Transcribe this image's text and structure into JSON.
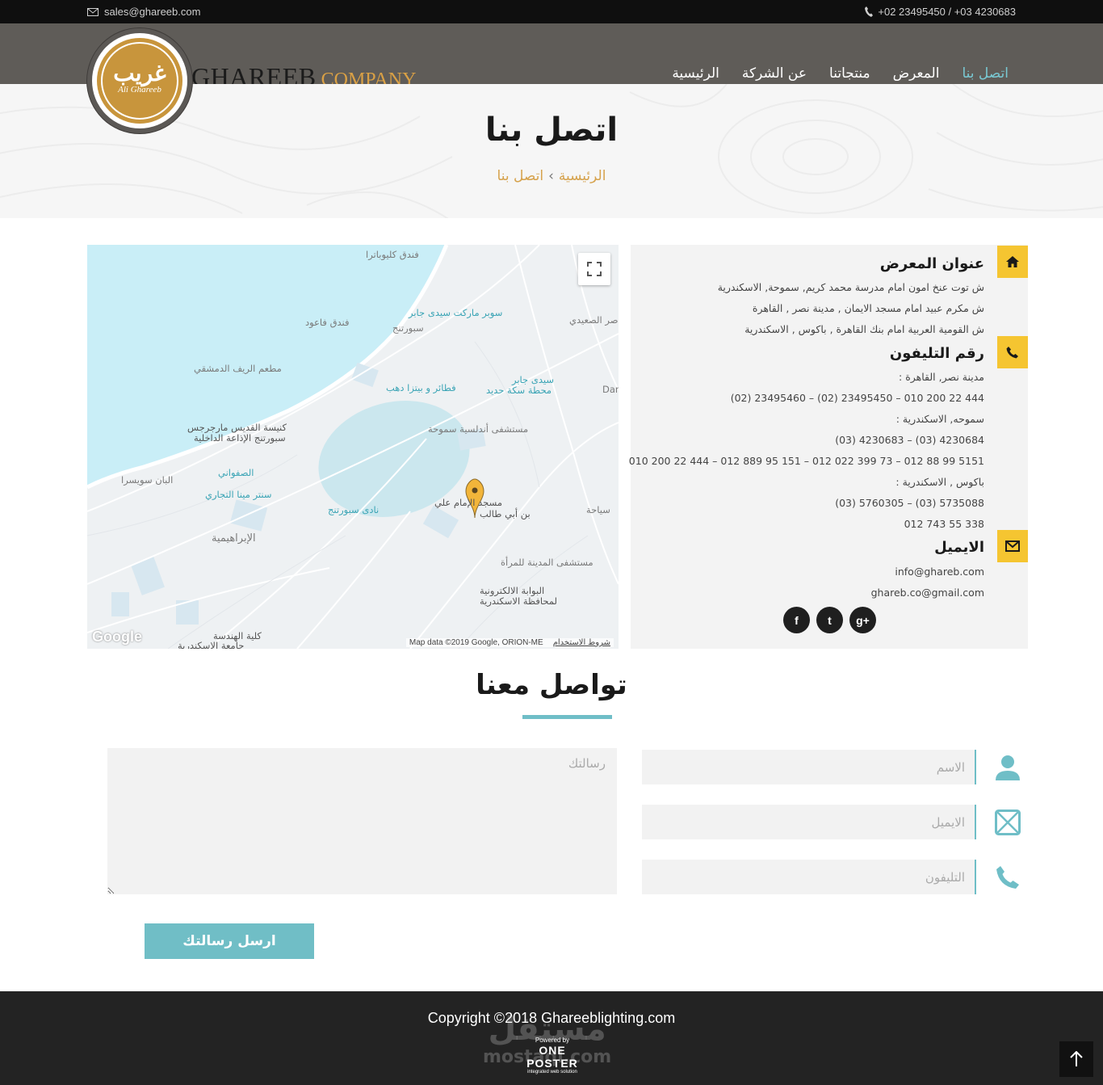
{
  "topbar": {
    "email": "sales@ghareeb.com",
    "phones": "+02 23495450 / +03 4230683"
  },
  "logo": {
    "arabic": "غريب",
    "english": "Ali Ghareeb"
  },
  "brand": {
    "name": "GHAREEB",
    "suffix": "COMPANY"
  },
  "nav": {
    "items": [
      {
        "label": "الرئيسية"
      },
      {
        "label": "عن الشركة"
      },
      {
        "label": "منتجاتنا"
      },
      {
        "label": "المعرض"
      },
      {
        "label": "اتصل بنا",
        "active": true
      }
    ]
  },
  "page": {
    "title": "اتصل بنا",
    "breadcrumb_home": "الرئيسية",
    "breadcrumb_sep": "›",
    "breadcrumb_current": "اتصل بنا"
  },
  "map": {
    "labels": {
      "l1": "فندق كليوباترا",
      "l2": "سوبر ماركت سيدى جابر",
      "l3": "سبورتنج",
      "l4": "فندق فاعود",
      "l5": "مطعم الريف الدمشقي",
      "l6": "فطائر و بيتزا دهب",
      "l7": "سيدى جابر",
      "l8": "محطة سكة حديد",
      "l9": "كنيسة القديس مارجرجس",
      "l10": "سبورتنج الإذاعة الداخلية",
      "l11": "مستشفى أندلسية سموحة",
      "l12": "الصفواني",
      "l13": "البان سويسرا",
      "l14": "سنتر مينا التجاري",
      "l15": "نادى سبورتنج",
      "l16": "مسجد الإمام علي",
      "l17": "بن أبي طالب",
      "l18": "الإبراهيمية",
      "l19": "مستشفى المدينة للمرأة",
      "l20": "البوابة الالكترونية",
      "l21": "لمحافظة الاسكندرية",
      "l22": "كلية الهندسة",
      "l23": "جامعة الاسكندرية",
      "l24": "صر الصعيدي",
      "l25": "Dar",
      "l26": "سياحة"
    },
    "google": "Google",
    "attribution": "Map data ©2019 Google, ORION-ME",
    "terms": "شروط الاستخدام"
  },
  "info": {
    "address_title": "عنوان المعرض",
    "address_lines": [
      "ش توت عنخ امون امام مدرسة محمد كريم, سموحة, الاسكندرية",
      "ش مكرم عبيد امام مسجد الايمان , مدينة نصر , القاهرة",
      "ش القومية العربية امام بنك القاهرة , باكوس , الاسكندرية"
    ],
    "phone_title": "رقم التليفون",
    "phone_lines": [
      "مدينة نصر, القاهرة :",
      "(02) 23495460 – (02) 23495450 – 010 200 22 444",
      "سموحه, الاسكندرية :",
      "(03) 4230683 – (03) 4230684",
      "010 200 22 444 – 012 889 95 151 – 012 022 399 73 – 012 88 99 5151",
      "باكوس , الاسكندرية :",
      "(03) 5760305 – (03) 5735088",
      "012 743 55 338"
    ],
    "email_title": "الايميل",
    "email_lines": [
      "info@ghareb.com",
      "ghareb.co@gmail.com"
    ],
    "social": {
      "facebook": "f",
      "twitter": "t",
      "gplus": "g+"
    }
  },
  "contact": {
    "title": "تواصل معنا",
    "name_placeholder": "الاسم",
    "email_placeholder": "الايميل",
    "phone_placeholder": "التليفون",
    "message_placeholder": "رسالتك",
    "submit": "ارسل رسالتك"
  },
  "footer": {
    "copyright": "Copyright ©2018 Ghareeblighting.com",
    "powered_by": "Powered by",
    "poster": "ONE POSTER",
    "poster_tag": "integrated web solution",
    "watermark_ar": "مستقل",
    "watermark_en": "mostaql.com"
  },
  "colors": {
    "accent": "#6fbec7",
    "gold": "#d6a24c",
    "icon_yellow": "#f5c531",
    "nav_bg": "#5f5c58",
    "footer_bg": "#232323"
  }
}
